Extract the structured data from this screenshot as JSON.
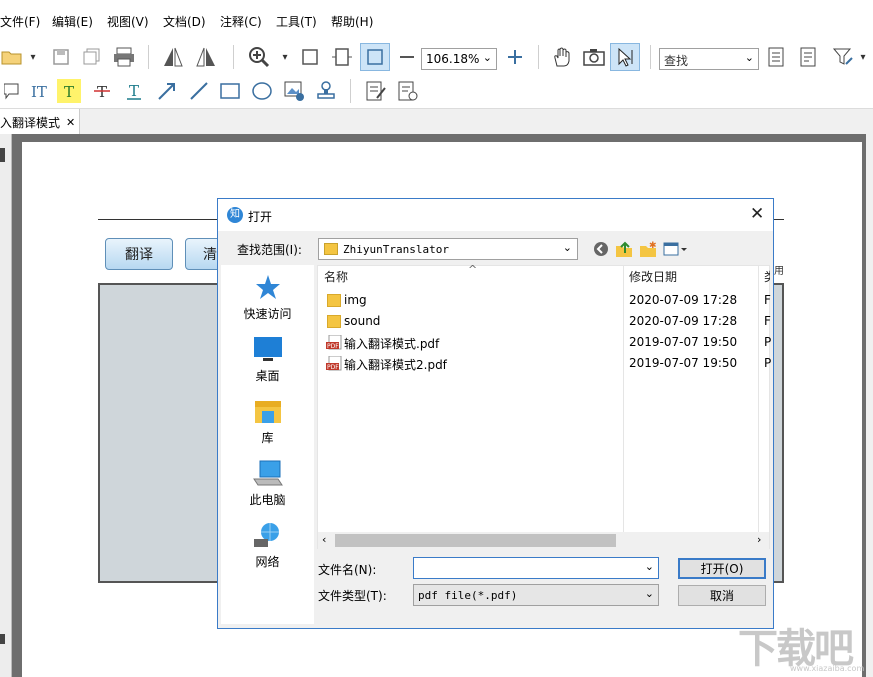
{
  "menu": [
    "文件(F)",
    "编辑(E)",
    "视图(V)",
    "文档(D)",
    "注释(C)",
    "工具(T)",
    "帮助(H)"
  ],
  "toolbar": {
    "zoom_value": "106.18%",
    "search_placeholder": "查找"
  },
  "tab": {
    "label": "入翻译模式",
    "close": "✕"
  },
  "app": {
    "translate_button": "翻译",
    "clear_button": "清",
    "side_text": "用"
  },
  "dialog": {
    "title": "打开",
    "title_icon": "知",
    "look_in_label": "查找范围(I):",
    "look_in_value": "ZhiyunTranslator",
    "places": [
      {
        "label": "快速访问",
        "icon": "star-icon"
      },
      {
        "label": "桌面",
        "icon": "desktop-icon"
      },
      {
        "label": "库",
        "icon": "library-icon"
      },
      {
        "label": "此电脑",
        "icon": "computer-icon"
      },
      {
        "label": "网络",
        "icon": "network-icon"
      }
    ],
    "columns": {
      "name": "名称",
      "date": "修改日期",
      "type": "类"
    },
    "files": [
      {
        "name": "img",
        "date": "2020-07-09 17:28",
        "type": "F",
        "kind": "folder"
      },
      {
        "name": "sound",
        "date": "2020-07-09 17:28",
        "type": "F",
        "kind": "folder"
      },
      {
        "name": "输入翻译模式.pdf",
        "date": "2019-07-07 19:50",
        "type": "P",
        "kind": "pdf"
      },
      {
        "name": "输入翻译模式2.pdf",
        "date": "2019-07-07 19:50",
        "type": "P",
        "kind": "pdf"
      }
    ],
    "filename_label": "文件名(N):",
    "filename_value": "",
    "filetype_label": "文件类型(T):",
    "filetype_value": "pdf file(*.pdf)",
    "open_button": "打开(O)",
    "cancel_button": "取消"
  },
  "watermark": {
    "text": "下载吧",
    "url": "www.xiazaiba.com"
  },
  "colors": {
    "accent": "#3a7bc8",
    "folder": "#f4c542",
    "pdf": "#c0392b",
    "app_button": "#b7d8f1"
  }
}
